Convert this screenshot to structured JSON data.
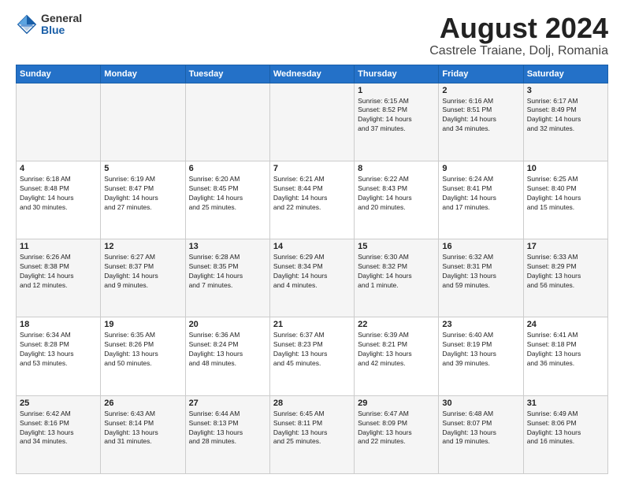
{
  "header": {
    "logo_general": "General",
    "logo_blue": "Blue",
    "month_title": "August 2024",
    "location": "Castrele Traiane, Dolj, Romania"
  },
  "days_of_week": [
    "Sunday",
    "Monday",
    "Tuesday",
    "Wednesday",
    "Thursday",
    "Friday",
    "Saturday"
  ],
  "weeks": [
    [
      {
        "day": "",
        "info": ""
      },
      {
        "day": "",
        "info": ""
      },
      {
        "day": "",
        "info": ""
      },
      {
        "day": "",
        "info": ""
      },
      {
        "day": "1",
        "info": "Sunrise: 6:15 AM\nSunset: 8:52 PM\nDaylight: 14 hours\nand 37 minutes."
      },
      {
        "day": "2",
        "info": "Sunrise: 6:16 AM\nSunset: 8:51 PM\nDaylight: 14 hours\nand 34 minutes."
      },
      {
        "day": "3",
        "info": "Sunrise: 6:17 AM\nSunset: 8:49 PM\nDaylight: 14 hours\nand 32 minutes."
      }
    ],
    [
      {
        "day": "4",
        "info": "Sunrise: 6:18 AM\nSunset: 8:48 PM\nDaylight: 14 hours\nand 30 minutes."
      },
      {
        "day": "5",
        "info": "Sunrise: 6:19 AM\nSunset: 8:47 PM\nDaylight: 14 hours\nand 27 minutes."
      },
      {
        "day": "6",
        "info": "Sunrise: 6:20 AM\nSunset: 8:45 PM\nDaylight: 14 hours\nand 25 minutes."
      },
      {
        "day": "7",
        "info": "Sunrise: 6:21 AM\nSunset: 8:44 PM\nDaylight: 14 hours\nand 22 minutes."
      },
      {
        "day": "8",
        "info": "Sunrise: 6:22 AM\nSunset: 8:43 PM\nDaylight: 14 hours\nand 20 minutes."
      },
      {
        "day": "9",
        "info": "Sunrise: 6:24 AM\nSunset: 8:41 PM\nDaylight: 14 hours\nand 17 minutes."
      },
      {
        "day": "10",
        "info": "Sunrise: 6:25 AM\nSunset: 8:40 PM\nDaylight: 14 hours\nand 15 minutes."
      }
    ],
    [
      {
        "day": "11",
        "info": "Sunrise: 6:26 AM\nSunset: 8:38 PM\nDaylight: 14 hours\nand 12 minutes."
      },
      {
        "day": "12",
        "info": "Sunrise: 6:27 AM\nSunset: 8:37 PM\nDaylight: 14 hours\nand 9 minutes."
      },
      {
        "day": "13",
        "info": "Sunrise: 6:28 AM\nSunset: 8:35 PM\nDaylight: 14 hours\nand 7 minutes."
      },
      {
        "day": "14",
        "info": "Sunrise: 6:29 AM\nSunset: 8:34 PM\nDaylight: 14 hours\nand 4 minutes."
      },
      {
        "day": "15",
        "info": "Sunrise: 6:30 AM\nSunset: 8:32 PM\nDaylight: 14 hours\nand 1 minute."
      },
      {
        "day": "16",
        "info": "Sunrise: 6:32 AM\nSunset: 8:31 PM\nDaylight: 13 hours\nand 59 minutes."
      },
      {
        "day": "17",
        "info": "Sunrise: 6:33 AM\nSunset: 8:29 PM\nDaylight: 13 hours\nand 56 minutes."
      }
    ],
    [
      {
        "day": "18",
        "info": "Sunrise: 6:34 AM\nSunset: 8:28 PM\nDaylight: 13 hours\nand 53 minutes."
      },
      {
        "day": "19",
        "info": "Sunrise: 6:35 AM\nSunset: 8:26 PM\nDaylight: 13 hours\nand 50 minutes."
      },
      {
        "day": "20",
        "info": "Sunrise: 6:36 AM\nSunset: 8:24 PM\nDaylight: 13 hours\nand 48 minutes."
      },
      {
        "day": "21",
        "info": "Sunrise: 6:37 AM\nSunset: 8:23 PM\nDaylight: 13 hours\nand 45 minutes."
      },
      {
        "day": "22",
        "info": "Sunrise: 6:39 AM\nSunset: 8:21 PM\nDaylight: 13 hours\nand 42 minutes."
      },
      {
        "day": "23",
        "info": "Sunrise: 6:40 AM\nSunset: 8:19 PM\nDaylight: 13 hours\nand 39 minutes."
      },
      {
        "day": "24",
        "info": "Sunrise: 6:41 AM\nSunset: 8:18 PM\nDaylight: 13 hours\nand 36 minutes."
      }
    ],
    [
      {
        "day": "25",
        "info": "Sunrise: 6:42 AM\nSunset: 8:16 PM\nDaylight: 13 hours\nand 34 minutes."
      },
      {
        "day": "26",
        "info": "Sunrise: 6:43 AM\nSunset: 8:14 PM\nDaylight: 13 hours\nand 31 minutes."
      },
      {
        "day": "27",
        "info": "Sunrise: 6:44 AM\nSunset: 8:13 PM\nDaylight: 13 hours\nand 28 minutes."
      },
      {
        "day": "28",
        "info": "Sunrise: 6:45 AM\nSunset: 8:11 PM\nDaylight: 13 hours\nand 25 minutes."
      },
      {
        "day": "29",
        "info": "Sunrise: 6:47 AM\nSunset: 8:09 PM\nDaylight: 13 hours\nand 22 minutes."
      },
      {
        "day": "30",
        "info": "Sunrise: 6:48 AM\nSunset: 8:07 PM\nDaylight: 13 hours\nand 19 minutes."
      },
      {
        "day": "31",
        "info": "Sunrise: 6:49 AM\nSunset: 8:06 PM\nDaylight: 13 hours\nand 16 minutes."
      }
    ]
  ]
}
